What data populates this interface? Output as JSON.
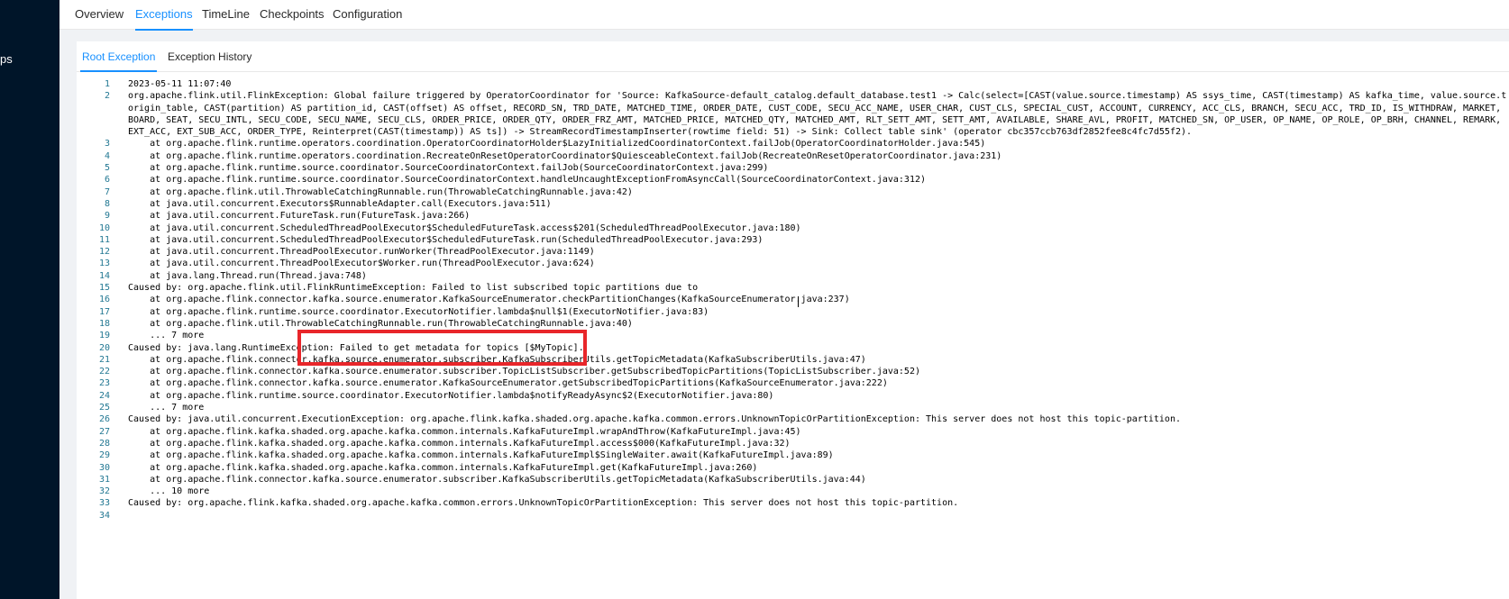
{
  "sidebar": {
    "partial_text": "ps"
  },
  "tabs": [
    {
      "label": "Overview",
      "active": false
    },
    {
      "label": "Exceptions",
      "active": true
    },
    {
      "label": "TimeLine",
      "active": false
    },
    {
      "label": "Checkpoints",
      "active": false
    },
    {
      "label": "Configuration",
      "active": false
    }
  ],
  "subtabs": [
    {
      "label": "Root Exception",
      "active": true
    },
    {
      "label": "Exception History",
      "active": false
    }
  ],
  "exception": {
    "lines": [
      {
        "n": "1",
        "text": "2023-05-11 11:07:40"
      },
      {
        "n": "2",
        "text": "org.apache.flink.util.FlinkException: Global failure triggered by OperatorCoordinator for 'Source: KafkaSource-default_catalog.default_database.test1 -> Calc(select=[CAST(value.source.timestamp) AS ssys_time, CAST(timestamp) AS kafka_time, value.source.t"
      },
      {
        "n": "",
        "text": "origin_table, CAST(partition) AS partition_id, CAST(offset) AS offset, RECORD_SN, TRD_DATE, MATCHED_TIME, ORDER_DATE, CUST_CODE, SECU_ACC_NAME, USER_CHAR, CUST_CLS, SPECIAL_CUST, ACCOUNT, CURRENCY, ACC_CLS, BRANCH, SECU_ACC, TRD_ID, IS_WITHDRAW, MARKET, "
      },
      {
        "n": "",
        "text": "BOARD, SEAT, SECU_INTL, SECU_CODE, SECU_NAME, SECU_CLS, ORDER_PRICE, ORDER_QTY, ORDER_FRZ_AMT, MATCHED_PRICE, MATCHED_QTY, MATCHED_AMT, RLT_SETT_AMT, SETT_AMT, AVAILABLE, SHARE_AVL, PROFIT, MATCHED_SN, OP_USER, OP_NAME, OP_ROLE, OP_BRH, CHANNEL, REMARK, "
      },
      {
        "n": "",
        "text": "EXT_ACC, EXT_SUB_ACC, ORDER_TYPE, Reinterpret(CAST(timestamp)) AS ts]) -> StreamRecordTimestampInserter(rowtime field: 51) -> Sink: Collect table sink' (operator cbc357ccb763df2852fee8c4fc7d55f2)."
      },
      {
        "n": "3",
        "text": "    at org.apache.flink.runtime.operators.coordination.OperatorCoordinatorHolder$LazyInitializedCoordinatorContext.failJob(OperatorCoordinatorHolder.java:545)"
      },
      {
        "n": "4",
        "text": "    at org.apache.flink.runtime.operators.coordination.RecreateOnResetOperatorCoordinator$QuiesceableContext.failJob(RecreateOnResetOperatorCoordinator.java:231)"
      },
      {
        "n": "5",
        "text": "    at org.apache.flink.runtime.source.coordinator.SourceCoordinatorContext.failJob(SourceCoordinatorContext.java:299)"
      },
      {
        "n": "6",
        "text": "    at org.apache.flink.runtime.source.coordinator.SourceCoordinatorContext.handleUncaughtExceptionFromAsyncCall(SourceCoordinatorContext.java:312)"
      },
      {
        "n": "7",
        "text": "    at org.apache.flink.util.ThrowableCatchingRunnable.run(ThrowableCatchingRunnable.java:42)"
      },
      {
        "n": "8",
        "text": "    at java.util.concurrent.Executors$RunnableAdapter.call(Executors.java:511)"
      },
      {
        "n": "9",
        "text": "    at java.util.concurrent.FutureTask.run(FutureTask.java:266)"
      },
      {
        "n": "10",
        "text": "    at java.util.concurrent.ScheduledThreadPoolExecutor$ScheduledFutureTask.access$201(ScheduledThreadPoolExecutor.java:180)"
      },
      {
        "n": "11",
        "text": "    at java.util.concurrent.ScheduledThreadPoolExecutor$ScheduledFutureTask.run(ScheduledThreadPoolExecutor.java:293)"
      },
      {
        "n": "12",
        "text": "    at java.util.concurrent.ThreadPoolExecutor.runWorker(ThreadPoolExecutor.java:1149)"
      },
      {
        "n": "13",
        "text": "    at java.util.concurrent.ThreadPoolExecutor$Worker.run(ThreadPoolExecutor.java:624)"
      },
      {
        "n": "14",
        "text": "    at java.lang.Thread.run(Thread.java:748)"
      },
      {
        "n": "15",
        "text": "Caused by: org.apache.flink.util.FlinkRuntimeException: Failed to list subscribed topic partitions due to"
      },
      {
        "n": "16",
        "text": "    at org.apache.flink.connector.kafka.source.enumerator.KafkaSourceEnumerator.checkPartitionChanges(KafkaSourceEnumerator.java:237)"
      },
      {
        "n": "17",
        "text": "    at org.apache.flink.runtime.source.coordinator.ExecutorNotifier.lambda$null$1(ExecutorNotifier.java:83)"
      },
      {
        "n": "18",
        "text": "    at org.apache.flink.util.ThrowableCatchingRunnable.run(ThrowableCatchingRunnable.java:40)"
      },
      {
        "n": "19",
        "text": "    ... 7 more"
      },
      {
        "n": "20",
        "text": "Caused by: java.lang.RuntimeException: Failed to get metadata for topics [$MyTopic]."
      },
      {
        "n": "21",
        "text": "    at org.apache.flink.connector.kafka.source.enumerator.subscriber.KafkaSubscriberUtils.getTopicMetadata(KafkaSubscriberUtils.java:47)"
      },
      {
        "n": "22",
        "text": "    at org.apache.flink.connector.kafka.source.enumerator.subscriber.TopicListSubscriber.getSubscribedTopicPartitions(TopicListSubscriber.java:52)"
      },
      {
        "n": "23",
        "text": "    at org.apache.flink.connector.kafka.source.enumerator.KafkaSourceEnumerator.getSubscribedTopicPartitions(KafkaSourceEnumerator.java:222)"
      },
      {
        "n": "24",
        "text": "    at org.apache.flink.runtime.source.coordinator.ExecutorNotifier.lambda$notifyReadyAsync$2(ExecutorNotifier.java:80)"
      },
      {
        "n": "25",
        "text": "    ... 7 more"
      },
      {
        "n": "26",
        "text": "Caused by: java.util.concurrent.ExecutionException: org.apache.flink.kafka.shaded.org.apache.kafka.common.errors.UnknownTopicOrPartitionException: This server does not host this topic-partition."
      },
      {
        "n": "27",
        "text": "    at org.apache.flink.kafka.shaded.org.apache.kafka.common.internals.KafkaFutureImpl.wrapAndThrow(KafkaFutureImpl.java:45)"
      },
      {
        "n": "28",
        "text": "    at org.apache.flink.kafka.shaded.org.apache.kafka.common.internals.KafkaFutureImpl.access$000(KafkaFutureImpl.java:32)"
      },
      {
        "n": "29",
        "text": "    at org.apache.flink.kafka.shaded.org.apache.kafka.common.internals.KafkaFutureImpl$SingleWaiter.await(KafkaFutureImpl.java:89)"
      },
      {
        "n": "30",
        "text": "    at org.apache.flink.kafka.shaded.org.apache.kafka.common.internals.KafkaFutureImpl.get(KafkaFutureImpl.java:260)"
      },
      {
        "n": "31",
        "text": "    at org.apache.flink.connector.kafka.source.enumerator.subscriber.KafkaSubscriberUtils.getTopicMetadata(KafkaSubscriberUtils.java:44)"
      },
      {
        "n": "32",
        "text": "    ... 10 more"
      },
      {
        "n": "33",
        "text": "Caused by: org.apache.flink.kafka.shaded.org.apache.kafka.common.errors.UnknownTopicOrPartitionException: This server does not host this topic-partition."
      },
      {
        "n": "34",
        "text": ""
      }
    ]
  },
  "colors": {
    "accent": "#1890ff",
    "sidebar": "#001529",
    "highlight_box": "#e8262a",
    "line_number": "#237893"
  }
}
